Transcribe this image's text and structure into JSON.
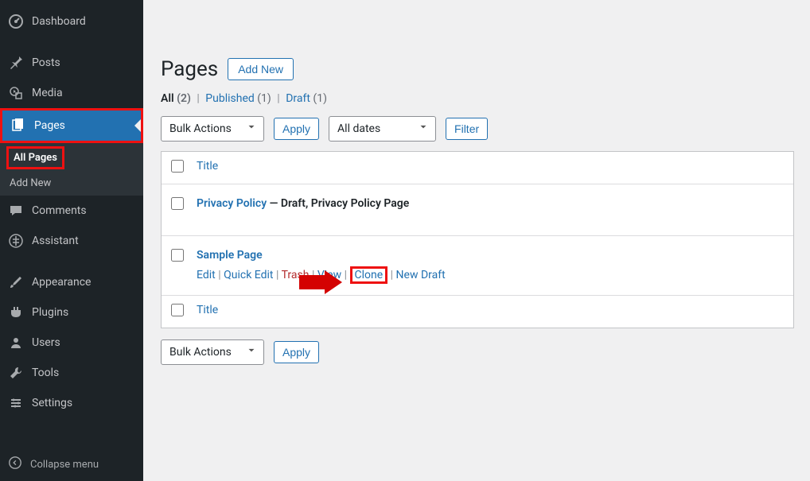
{
  "sidebar": {
    "items": [
      {
        "label": "Dashboard",
        "icon": "dashboard"
      },
      {
        "label": "Posts",
        "icon": "pin"
      },
      {
        "label": "Media",
        "icon": "media"
      },
      {
        "label": "Pages",
        "icon": "pages",
        "active": true
      },
      {
        "label": "Comments",
        "icon": "comments"
      },
      {
        "label": "Assistant",
        "icon": "assistant"
      },
      {
        "label": "Appearance",
        "icon": "brush"
      },
      {
        "label": "Plugins",
        "icon": "plugin"
      },
      {
        "label": "Users",
        "icon": "users"
      },
      {
        "label": "Tools",
        "icon": "tools"
      },
      {
        "label": "Settings",
        "icon": "settings"
      }
    ],
    "submenu": {
      "all_pages": "All Pages",
      "add_new": "Add New"
    },
    "collapse": "Collapse menu"
  },
  "header": {
    "title": "Pages",
    "add_new": "Add New"
  },
  "filters": {
    "all": "All",
    "all_count": "(2)",
    "published": "Published",
    "published_count": "(1)",
    "draft": "Draft",
    "draft_count": "(1)"
  },
  "actions": {
    "bulk": "Bulk Actions",
    "apply": "Apply",
    "all_dates": "All dates",
    "filter": "Filter"
  },
  "table": {
    "col_title": "Title",
    "rows": [
      {
        "title": "Privacy Policy",
        "state": " — Draft, Privacy Policy Page"
      },
      {
        "title": "Sample Page",
        "actions": {
          "edit": "Edit",
          "quick_edit": "Quick Edit",
          "trash": "Trash",
          "view": "View",
          "clone": "Clone",
          "new_draft": "New Draft"
        }
      }
    ]
  }
}
